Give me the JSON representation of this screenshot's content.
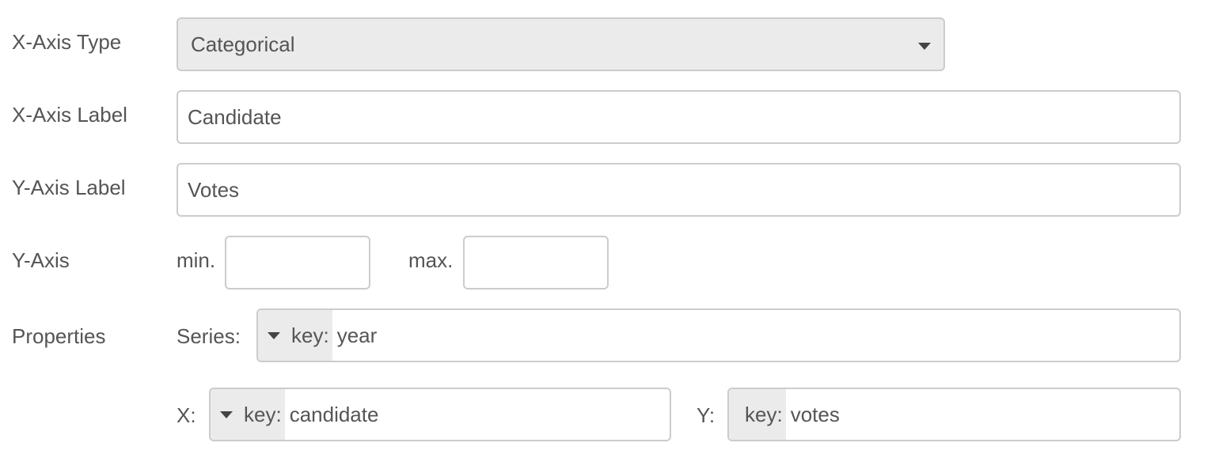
{
  "form": {
    "x_axis_type": {
      "label": "X-Axis Type",
      "selected": "Categorical"
    },
    "x_axis_label": {
      "label": "X-Axis Label",
      "value": "Candidate"
    },
    "y_axis_label": {
      "label": "Y-Axis Label",
      "value": "Votes"
    },
    "y_axis": {
      "label": "Y-Axis",
      "min_label": "min.",
      "min_value": "",
      "max_label": "max.",
      "max_value": ""
    },
    "properties": {
      "label": "Properties",
      "series": {
        "label": "Series:",
        "key_label": "key:",
        "value": "year"
      },
      "x": {
        "label": "X:",
        "key_label": "key:",
        "value": "candidate"
      },
      "y": {
        "label": "Y:",
        "key_label": "key:",
        "value": "votes"
      }
    }
  },
  "icons": {
    "dropdown": "chevron-down-icon"
  },
  "colors": {
    "text": "#555555",
    "border": "#cccccc",
    "select_background": "#ebebeb",
    "page_background": "#ffffff"
  }
}
